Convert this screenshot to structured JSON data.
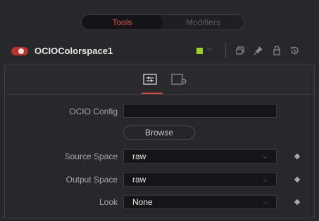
{
  "tabs": [
    {
      "label": "Tools",
      "active": true
    },
    {
      "label": "Modifiers",
      "active": false
    }
  ],
  "node": {
    "name": "OCIOColorspace1",
    "enabled": true,
    "color_swatch": "#9ad22c"
  },
  "header_icons": [
    "color-dropdown-chevron-icon",
    "versions-icon",
    "pin-icon",
    "lock-icon",
    "reset-icon"
  ],
  "panel_tabs": [
    {
      "name": "controls-tab-icon",
      "active": true
    },
    {
      "name": "settings-tab-icon",
      "active": false
    }
  ],
  "fields": {
    "ocio_config": {
      "label": "OCIO Config",
      "value": ""
    },
    "browse_label": "Browse",
    "source_space": {
      "label": "Source Space",
      "value": "raw"
    },
    "output_space": {
      "label": "Output Space",
      "value": "raw"
    },
    "look": {
      "label": "Look",
      "value": "None"
    }
  },
  "colors": {
    "accent": "#e2574e",
    "background": "#28282b"
  }
}
